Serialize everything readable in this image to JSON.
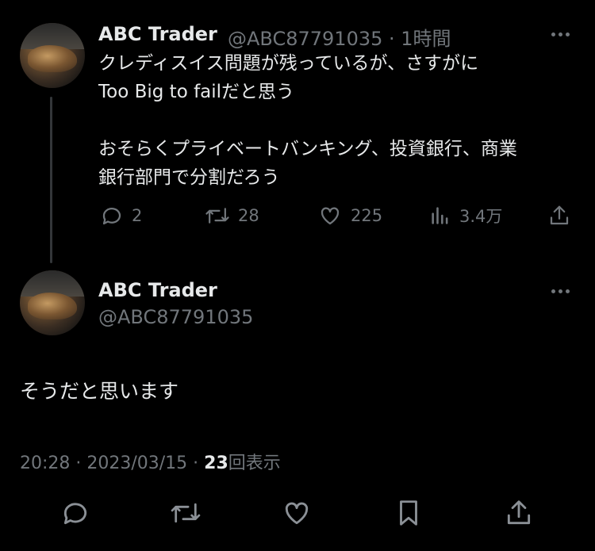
{
  "tweet1": {
    "display_name": "ABC Trader",
    "handle_time": "@ABC87791035 · 1時間",
    "text": "クレディスイス問題が残っているが、さすがに\nToo Big to failだと思う\n\nおそらくプライベートバンキング、投資銀行、商業\n銀行部門で分割だろう",
    "replies": "2",
    "retweets": "28",
    "likes": "225",
    "views": "3.4万"
  },
  "tweet2": {
    "display_name": "ABC Trader",
    "handle": "@ABC87791035",
    "text": "そうだと思います",
    "timestamp": "20:28 · 2023/03/15 · ",
    "view_count": "23",
    "view_label": "回表示"
  },
  "icons": {
    "reply": "reply-icon",
    "retweet": "retweet-icon",
    "like": "heart-icon",
    "views": "analytics-icon",
    "share": "share-icon",
    "bookmark": "bookmark-icon",
    "more": "more-icon"
  },
  "colors": {
    "background": "#000000",
    "text": "#e7e9ea",
    "secondary": "#71767b"
  }
}
